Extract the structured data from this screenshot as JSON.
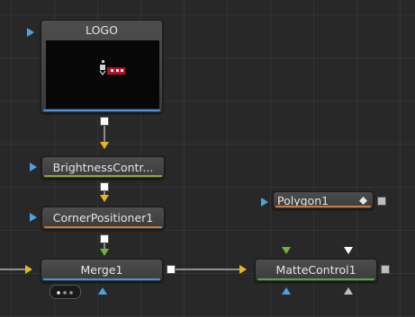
{
  "nodes": {
    "logo": {
      "title": "LOGO",
      "accent": "#4a90d9"
    },
    "brightness": {
      "title": "BrightnessContr...",
      "accent": "#8aa83c"
    },
    "corner": {
      "title": "CornerPositioner1",
      "accent": "#c77a3a"
    },
    "polygon": {
      "title": "Polygon1",
      "icon": "diamond-icon",
      "accent": "#c77a3a"
    },
    "merge": {
      "title": "Merge1",
      "accent": "#4a90d9",
      "more_icon": "more-dots-icon"
    },
    "matte": {
      "title": "MatteControl1",
      "accent": "#5aa04a"
    }
  },
  "colors": {
    "input_yellow": "#e6b620",
    "input_green": "#6fb33d",
    "input_white": "#ffffff",
    "input_blue": "#4aa3e0",
    "input_grey": "#bdbdbd",
    "canvas": "#282828"
  }
}
